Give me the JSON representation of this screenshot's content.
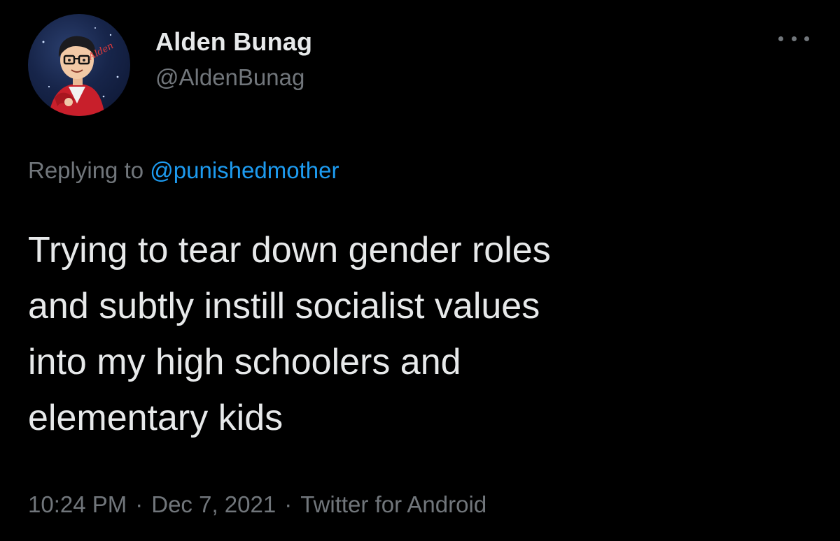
{
  "author": {
    "display_name": "Alden Bunag",
    "handle": "@AldenBunag",
    "avatar_signature": "Alden"
  },
  "more_icon": "more-horizontal-icon",
  "reply": {
    "prefix": "Replying to",
    "mention": "@punishedmother"
  },
  "tweet": {
    "lines": [
      "Trying to tear down gender roles",
      "and subtly instill socialist values",
      "into my high schoolers and",
      "elementary kids"
    ]
  },
  "meta": {
    "time": "10:24 PM",
    "separator": "·",
    "date": "Dec 7, 2021",
    "source": "Twitter for Android"
  },
  "colors": {
    "background": "#000000",
    "primary_text": "#e7e9ea",
    "secondary_text": "#71767b",
    "link": "#1d9bf0"
  }
}
